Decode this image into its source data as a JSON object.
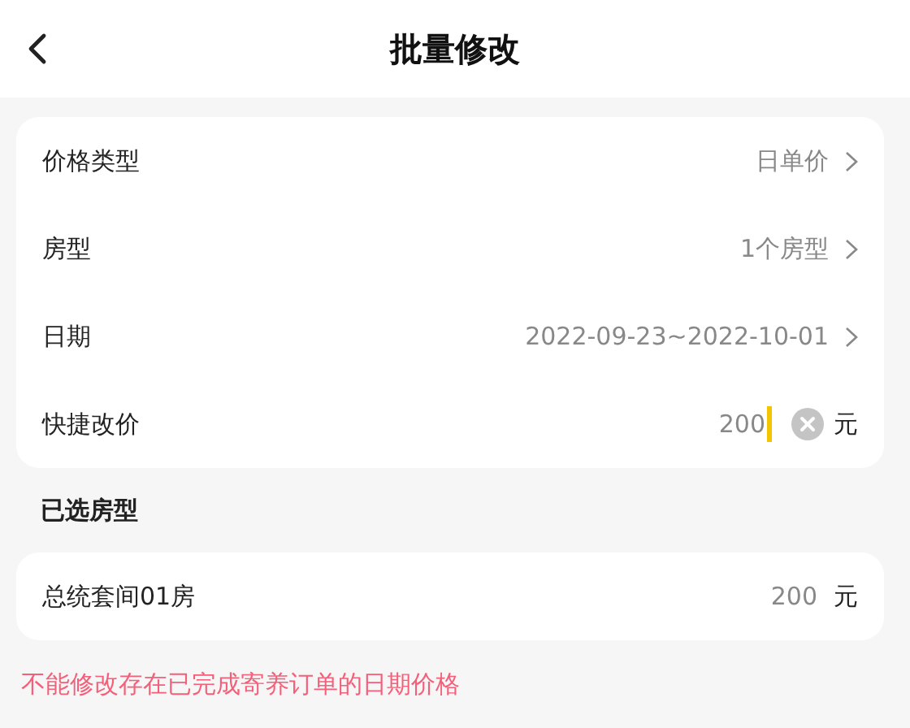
{
  "header": {
    "title": "批量修改"
  },
  "settings": [
    {
      "kind": "select",
      "label": "价格类型",
      "value": "日单价"
    },
    {
      "kind": "select",
      "label": "房型",
      "value": "1个房型"
    },
    {
      "kind": "select",
      "label": "日期",
      "value": "2022-09-23~2022-10-01"
    },
    {
      "kind": "input",
      "label": "快捷改价",
      "value": "200",
      "unit": "元"
    }
  ],
  "selected_section": {
    "title": "已选房型",
    "rooms": [
      {
        "name": "总统套间01房",
        "price": "200",
        "unit": "元"
      }
    ]
  },
  "warning": "不能修改存在已完成寄养订单的日期价格"
}
